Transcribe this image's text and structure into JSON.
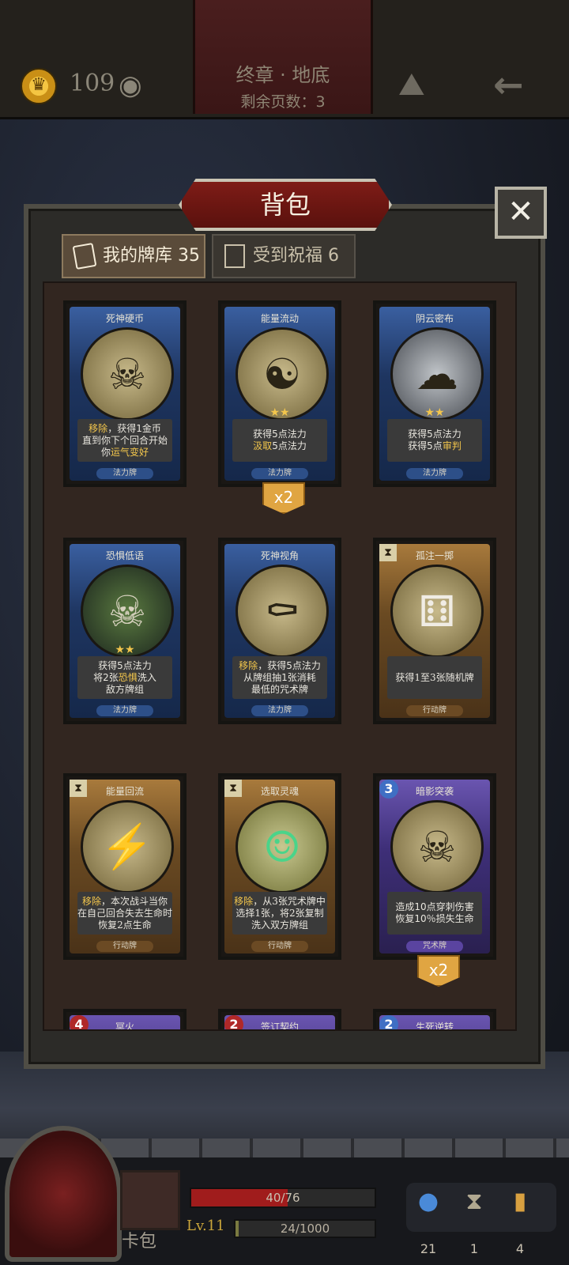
{
  "topbar": {
    "gold": "109",
    "chapter": "终章 · 地底",
    "pages_left": "剩余页数：3"
  },
  "panel": {
    "title": "背包",
    "close": "✕",
    "tabs": [
      {
        "label": "我的牌库 35",
        "active": true
      },
      {
        "label": "受到祝福 6",
        "active": false
      }
    ]
  },
  "cards": [
    {
      "name": "死神硬币",
      "desc1": "移除",
      "desc1b": "，获得1金币",
      "desc2": "直到你下个回合开始",
      "desc3a": "你",
      "desc3b": "运气变好",
      "type": "法力牌",
      "color": "blue"
    },
    {
      "name": "能量流动",
      "desc1": "获得5点法力",
      "desc2a": "汲取",
      "desc2b": "5点法力",
      "type": "法力牌",
      "color": "blue",
      "stars": "★★",
      "count": "x2"
    },
    {
      "name": "阴云密布",
      "desc1": "获得5点法力",
      "desc2a": "获得5点",
      "desc2b": "审判",
      "type": "法力牌",
      "color": "blue",
      "stars": "★★"
    },
    {
      "name": "恐惧低语",
      "desc1": "获得5点法力",
      "desc2a": "将2张",
      "desc2b": "恐惧",
      "desc2c": "洗入",
      "desc3": "敌方牌组",
      "type": "法力牌",
      "color": "blue",
      "stars": "★★"
    },
    {
      "name": "死神视角",
      "desc1a": "移除",
      "desc1b": "，获得5点法力",
      "desc2": "从牌组抽1张消耗",
      "desc3": "最低的咒术牌",
      "type": "法力牌",
      "color": "blue"
    },
    {
      "name": "孤注一掷",
      "desc1": "获得1至3张随机牌",
      "type": "行动牌",
      "color": "gold"
    },
    {
      "name": "能量回流",
      "desc1a": "移除",
      "desc1b": "，本次战斗当你",
      "desc2": "在自己回合失去生命时",
      "desc3": "恢复2点生命",
      "type": "行动牌",
      "color": "gold"
    },
    {
      "name": "选取灵魂",
      "desc1a": "移除",
      "desc1b": "，从3张咒术牌中",
      "desc2": "选择1张，将2张复制",
      "desc3": "洗入双方牌组",
      "type": "行动牌",
      "color": "gold"
    },
    {
      "name": "暗影突袭",
      "cost": "3",
      "desc1": "造成10点穿刺伤害",
      "desc2": "恢复10％损失生命",
      "type": "咒术牌",
      "color": "purple",
      "count": "x2"
    },
    {
      "name": "冥火",
      "cost": "4"
    },
    {
      "name": "签订契约",
      "cost": "2"
    },
    {
      "name": "生死逆转",
      "cost": "2"
    }
  ],
  "hud": {
    "deck_label": "卡包",
    "hp": "40/76",
    "hp_fraction": 0.526,
    "level": "Lv.11",
    "xp": "24/1000",
    "xp_fraction": 0.024,
    "resources": [
      {
        "icon": "potion-icon",
        "value": "21"
      },
      {
        "icon": "hourglass-icon",
        "value": "1"
      },
      {
        "icon": "cards-icon",
        "value": "4"
      }
    ]
  },
  "colors": {
    "accent_gold": "#f3c64c",
    "hp_red": "#a01c1c",
    "title_red": "#7e1c17"
  }
}
